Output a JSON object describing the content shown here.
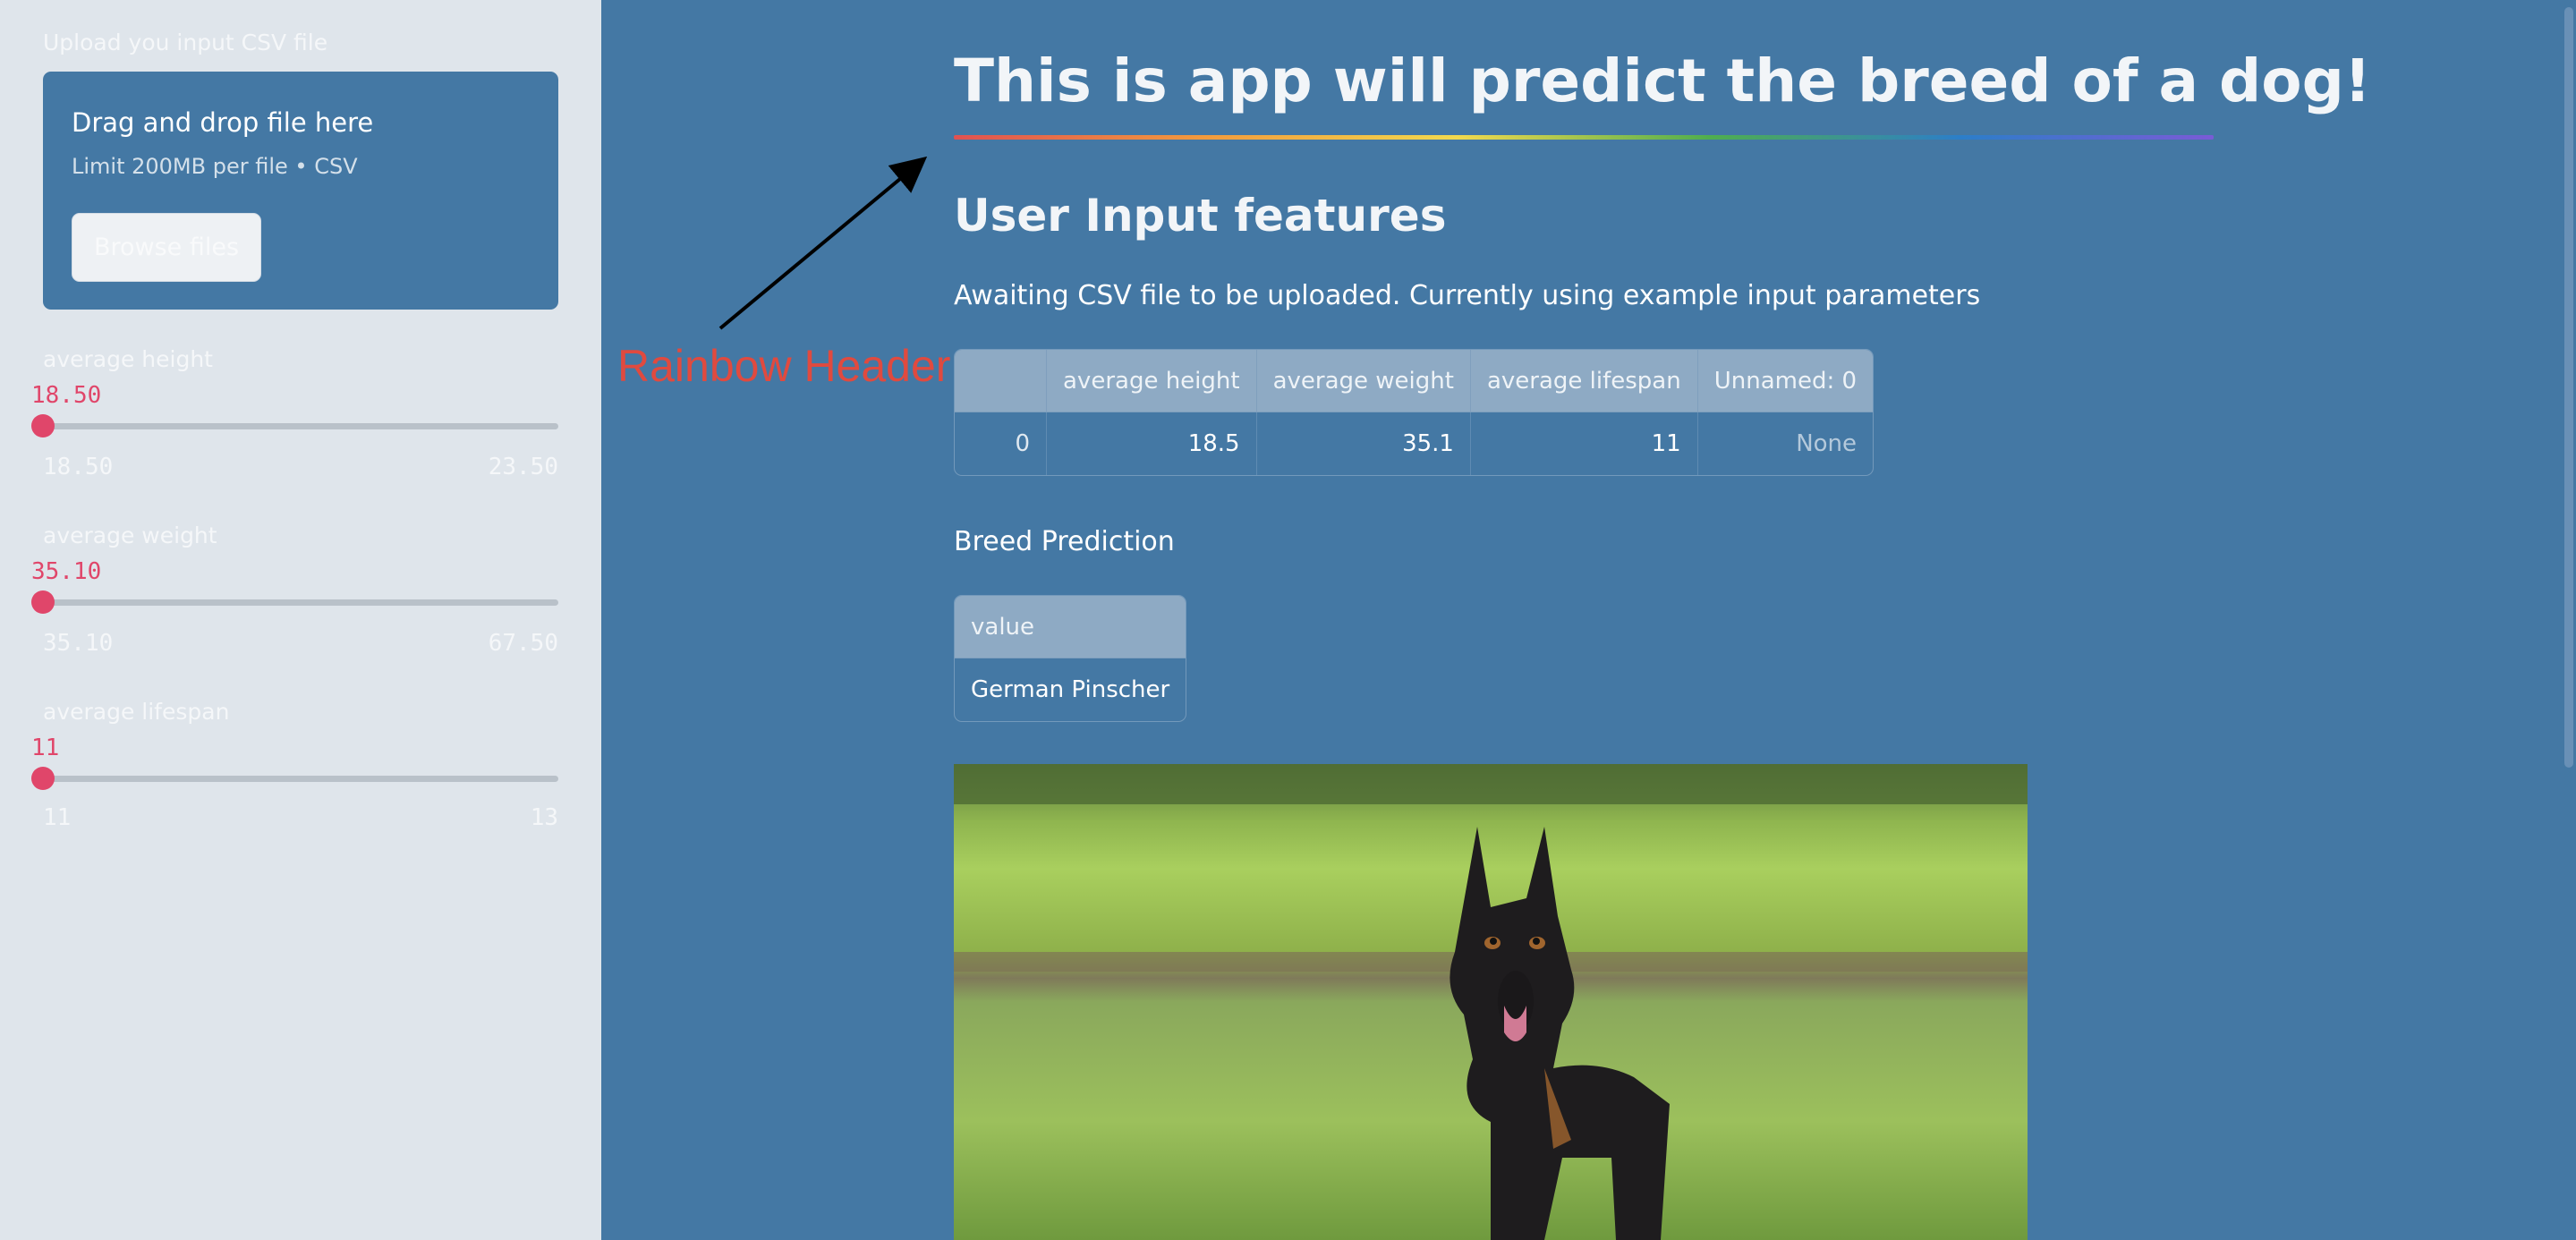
{
  "sidebar": {
    "upload_label": "Upload you input CSV file",
    "dropzone_title": "Drag and drop file here",
    "dropzone_subtitle": "Limit 200MB per file • CSV",
    "browse_button": "Browse files",
    "sliders": [
      {
        "label": "average height",
        "value": "18.50",
        "min": "18.50",
        "max": "23.50"
      },
      {
        "label": "average weight",
        "value": "35.10",
        "min": "35.10",
        "max": "67.50"
      },
      {
        "label": "average lifespan",
        "value": "11",
        "min": "11",
        "max": "13"
      }
    ]
  },
  "main": {
    "title": "This is app will predict the breed of a dog!",
    "section_title": "User Input features",
    "info_text": "Awaiting CSV file to be uploaded. Currently using example input parameters",
    "annotation": "Rainbow Header",
    "input_table": {
      "columns": [
        "",
        "average height",
        "average weight",
        "average lifespan",
        "Unnamed: 0"
      ],
      "rows": [
        [
          "0",
          "18.5",
          "35.1",
          "11",
          "None"
        ]
      ]
    },
    "prediction_label": "Breed Prediction",
    "prediction_table": {
      "columns": [
        "value"
      ],
      "rows": [
        [
          "German Pinscher"
        ]
      ]
    }
  },
  "colors": {
    "sidebar_bg": "#dfe5eb",
    "main_bg": "#4478a4",
    "slider_accent": "#e0466a",
    "annotation": "#e04a3f"
  }
}
